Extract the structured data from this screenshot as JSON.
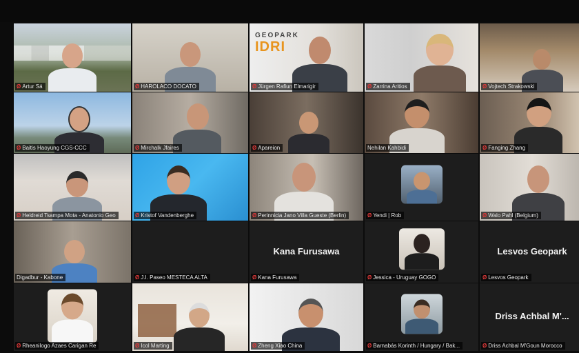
{
  "tiles": [
    {
      "name": "Artur Sá",
      "muted": true
    },
    {
      "name": "HAROLACO DOCATO",
      "muted": true
    },
    {
      "name": "Jürgen Rafiun Elmarigir",
      "muted": true
    },
    {
      "name": "Zarrina Aritios",
      "muted": true
    },
    {
      "name": "Vojtech Strakowski",
      "muted": true
    },
    {
      "name": "Baitis Haoyung CGS-CCC",
      "muted": true
    },
    {
      "name": "Mirchalk Jfaires",
      "muted": true
    },
    {
      "name": "Apareion",
      "muted": true
    },
    {
      "name": "Nehilan Kahbidi",
      "muted": false
    },
    {
      "name": "Fanging Zhang",
      "muted": true
    },
    {
      "name": "Heldreid Tsampa Mota - Anatonio Geo",
      "muted": true
    },
    {
      "name": "Kristof Vandenberghe",
      "muted": true
    },
    {
      "name": "Perinnicia Jano Villa Gueste (Berlin)",
      "muted": true
    },
    {
      "name": "Yendi | Rob",
      "muted": true
    },
    {
      "name": "Walo Pahl (Belgium)",
      "muted": true
    },
    {
      "name": "Digadbur - Kabone",
      "muted": false
    },
    {
      "name": "J.I. Paseo MESTECA ALTA",
      "muted": true
    },
    {
      "name": "Kana Furusawa",
      "muted": true,
      "center": "Kana Furusawa"
    },
    {
      "name": "Jessica - Uruguay GOGO",
      "muted": true
    },
    {
      "name": "Lesvos Geopark",
      "muted": true,
      "center": "Lesvos Geopark"
    },
    {
      "name": "Rheanilogo Azaes Carigan Re",
      "muted": true
    },
    {
      "name": "Icol Marting",
      "muted": true
    },
    {
      "name": "Zheng Xiao China",
      "muted": true
    },
    {
      "name": "Barnabás Korinth / Hungary / Bak...",
      "muted": true
    },
    {
      "name": "Driss Achbal M'Goun Morocco",
      "muted": true,
      "center": "Driss Achbal M'..."
    }
  ],
  "geopark_logo": {
    "top": "GEOPARK",
    "main": "IDRI"
  },
  "mic_icon": "mic-muted-icon",
  "colors": {
    "active_border": "#5fd35f",
    "muted_mic": "#e23a3a",
    "logo_orange": "#e8941e"
  }
}
